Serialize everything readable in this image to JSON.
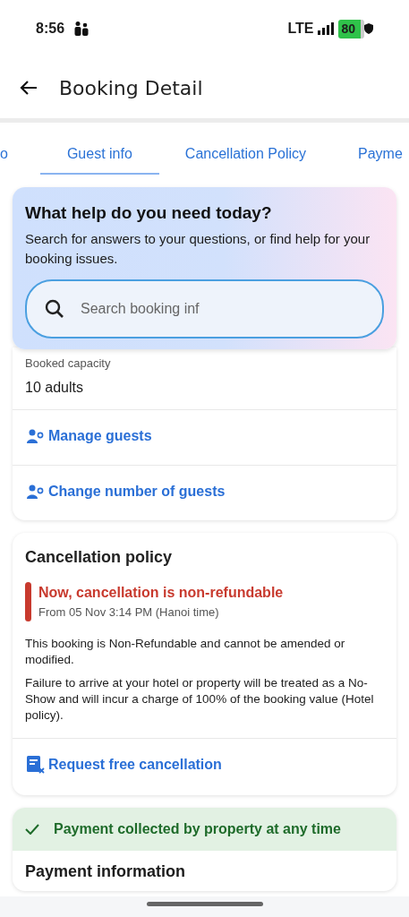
{
  "status_bar": {
    "time": "8:56",
    "network": "LTE",
    "battery": "80"
  },
  "header": {
    "title": "Booking Detail"
  },
  "tabs": [
    {
      "label": "o",
      "selected": false
    },
    {
      "label": "Guest info",
      "selected": true
    },
    {
      "label": "Cancellation Policy",
      "selected": false
    },
    {
      "label": "Payme",
      "selected": false
    }
  ],
  "help": {
    "title": "What help do you need today?",
    "text": "Search for answers to your questions, or find help for your booking issues.",
    "search": {
      "placeholder": "Search booking inf"
    }
  },
  "guest_card": {
    "label": "Booked capacity",
    "value": "10 adults",
    "actions": [
      {
        "label": "Manage guests",
        "kind": "guests"
      },
      {
        "label": "Change number of guests",
        "kind": "guests"
      }
    ]
  },
  "cancellation": {
    "title": "Cancellation policy",
    "alert": {
      "title": "Now, cancellation is non-refundable",
      "subtitle": "From 05 Nov 3:14 PM (Hanoi time)"
    },
    "paragraphs": [
      "This booking is Non-Refundable and cannot be amended or modified.",
      "Failure to arrive at your hotel or property will be treated as a No-Show and will incur a charge of 100% of the booking value (Hotel policy)."
    ],
    "action": {
      "label": "Request free cancellation",
      "kind": "cancel"
    }
  },
  "payment": {
    "banner": "Payment collected by property at any time",
    "heading": "Payment information"
  }
}
